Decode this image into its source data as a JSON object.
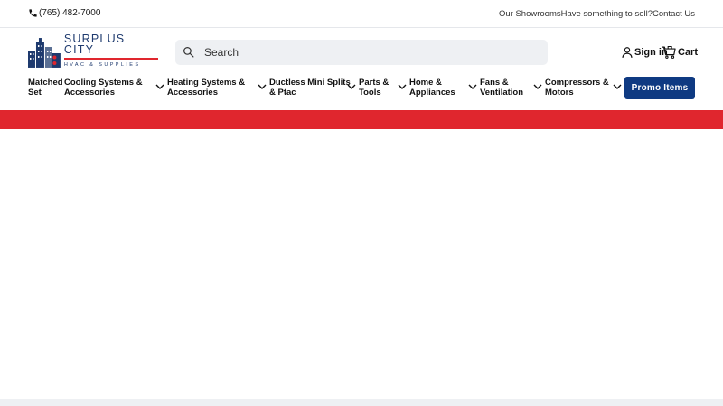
{
  "topbar": {
    "phone": "(765) 482-7000",
    "links": [
      "Our Showrooms",
      "Have something to sell?",
      "Contact Us"
    ]
  },
  "logo": {
    "name": "SURPLUS CITY",
    "subtitle": "HVAC & SUPPLIES"
  },
  "search": {
    "placeholder": "Search"
  },
  "account": {
    "sign_in": "Sign in",
    "cart": "Cart"
  },
  "nav": {
    "items": [
      {
        "label": "Matched\nSet",
        "has_dropdown": false
      },
      {
        "label": "Cooling Systems &\nAccessories",
        "has_dropdown": true
      },
      {
        "label": "Heating Systems &\nAccessories",
        "has_dropdown": true
      },
      {
        "label": "Ductless Mini Splits\n& Ptac",
        "has_dropdown": true
      },
      {
        "label": "Parts &\nTools",
        "has_dropdown": true
      },
      {
        "label": "Home &\nAppliances",
        "has_dropdown": true
      },
      {
        "label": "Fans &\nVentilation",
        "has_dropdown": true
      },
      {
        "label": "Compressors &\nMotors",
        "has_dropdown": true
      }
    ],
    "promo": "Promo Items"
  },
  "colors": {
    "brand_blue": "#0f3a82",
    "brand_red": "#e0262e",
    "search_bg": "#eef0f3"
  }
}
